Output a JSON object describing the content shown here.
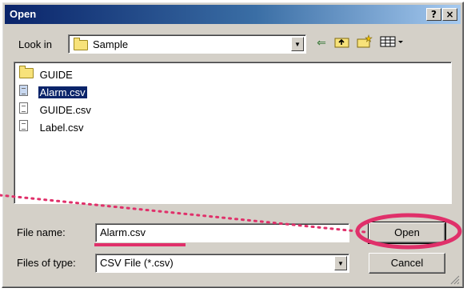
{
  "window": {
    "title": "Open",
    "help_label": "?",
    "close_label": "×"
  },
  "look_in": {
    "label": "Look in",
    "value": "Sample"
  },
  "toolbar": {
    "back_icon": "back-arrow-icon",
    "up_icon": "up-one-level-icon",
    "new_folder_icon": "new-folder-icon",
    "views_icon": "views-menu-icon"
  },
  "file_list": {
    "items": [
      {
        "name": "GUIDE",
        "type": "folder"
      },
      {
        "name": "Alarm.csv",
        "type": "file",
        "selected": true
      },
      {
        "name": "GUIDE.csv",
        "type": "file"
      },
      {
        "name": "Label.csv",
        "type": "file"
      }
    ]
  },
  "file_name": {
    "label": "File name:",
    "value": "Alarm.csv"
  },
  "files_of_type": {
    "label": "Files of type:",
    "value": "CSV File (*.csv)"
  },
  "buttons": {
    "open_label": "Open",
    "cancel_label": "Cancel"
  },
  "colors": {
    "dialog_face": "#d4d0c8",
    "title_gradient_start": "#0a246a",
    "selection": "#0a246a",
    "annotation": "#e0306a"
  }
}
